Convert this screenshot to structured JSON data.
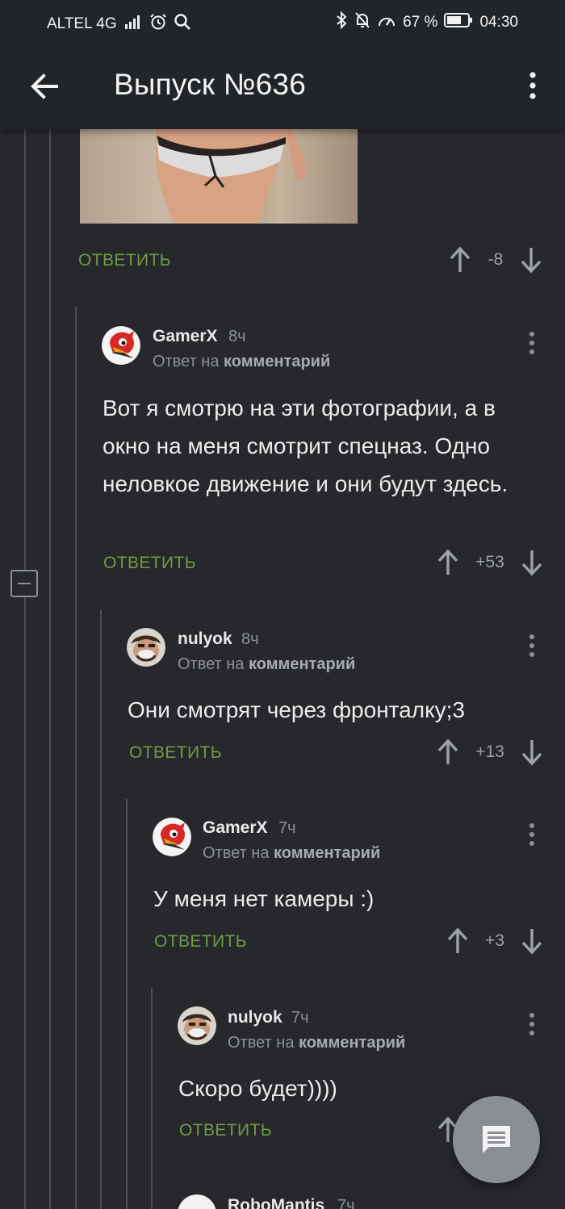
{
  "status_bar": {
    "carrier": "ALTEL 4G",
    "network_badge": "4G",
    "battery": "67 %",
    "time": "04:30",
    "icons": [
      "signal-icon",
      "alarm-icon",
      "search-icon",
      "bluetooth-icon",
      "mute-bell-icon",
      "speed-icon",
      "battery-icon"
    ]
  },
  "app_bar": {
    "title": "Выпуск №636",
    "back_icon": "arrow-left-icon",
    "menu_icon": "more-vert-icon"
  },
  "labels": {
    "reply": "ОТВЕТИТЬ",
    "reply_to_prefix": "Ответ на",
    "reply_to_target": "комментарий"
  },
  "top_comment_footer": {
    "rating": "-8"
  },
  "comments": [
    {
      "author": "GamerX",
      "time": "8ч",
      "text": "Вот я смотрю на эти фотографии, а в окно на меня смотрит спецназ. Одно неловкое движение и они будут здесь.",
      "rating": "+53"
    },
    {
      "author": "nulyok",
      "time": "8ч",
      "text": "Они смотрят через фронталку;3",
      "rating": "+13"
    },
    {
      "author": "GamerX",
      "time": "7ч",
      "text": "У меня нет камеры :)",
      "rating": "+3"
    },
    {
      "author": "nulyok",
      "time": "7ч",
      "text": "Скоро будет))))",
      "rating": ""
    },
    {
      "author": "RoboMantis",
      "time": "7ч"
    }
  ],
  "colors": {
    "background": "#26282b",
    "bar": "#222528",
    "reply_green": "#6f9a47",
    "thread_line": "#4a4d52",
    "fab": "#8b8e93"
  },
  "fab": {
    "icon": "comment-icon"
  }
}
